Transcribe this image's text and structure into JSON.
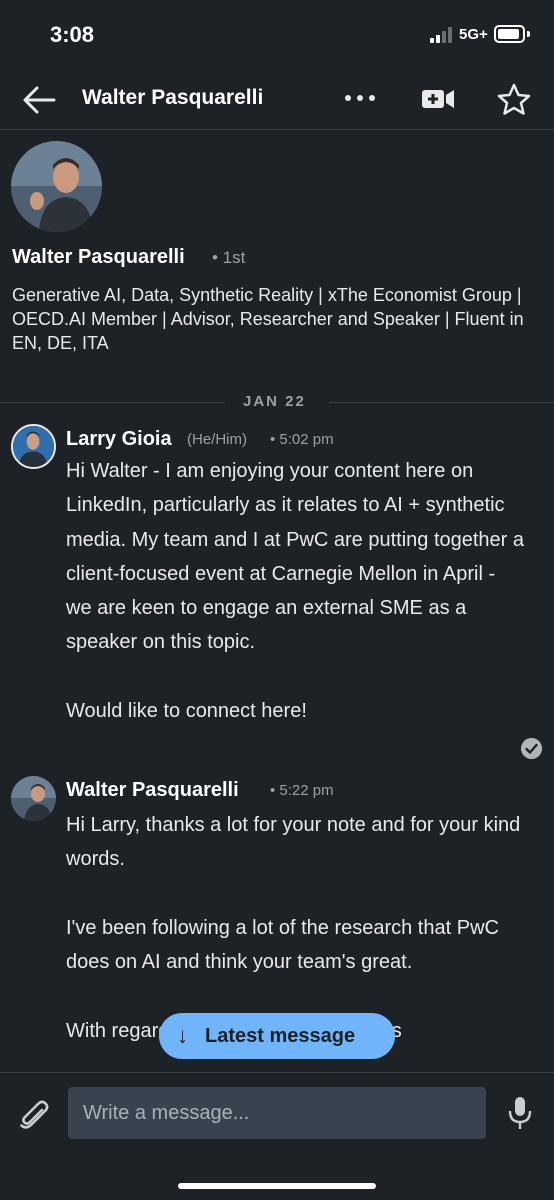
{
  "status_bar": {
    "time": "3:08",
    "network": "5G+"
  },
  "header": {
    "title": "Walter Pasquarelli"
  },
  "profile": {
    "name": "Walter Pasquarelli",
    "degree": "• 1st",
    "headline": "Generative AI, Data, Synthetic Reality | xThe Economist Group | OECD.AI Member | Advisor, Researcher and Speaker | Fluent in EN, DE, ITA"
  },
  "conversation": {
    "date_divider": "JAN 22",
    "messages": [
      {
        "sender": "Larry Gioia",
        "pronouns": "(He/Him)",
        "time": "• 5:02 pm",
        "paragraphs": [
          "Hi Walter - I am enjoying your content here on LinkedIn, particularly as it relates to AI + synthetic media. My team and I at PwC are putting together a client-focused event at Carnegie Mellon in April - we are keen to engage an external SME as a speaker on this topic.",
          "Would like to connect here!"
        ]
      },
      {
        "sender": "Walter Pasquarelli",
        "time": "• 5:22 pm",
        "paragraphs": [
          "Hi Larry, thanks a lot for your note and for your kind words.",
          "I've been following a lot of the research that PwC does on AI and think your team's great.",
          "With regards to the speaking opp, this"
        ]
      }
    ]
  },
  "latest_button": {
    "arrow": "↓",
    "label": "Latest message"
  },
  "composer": {
    "placeholder": "Write a message..."
  },
  "colors": {
    "background": "#1d2226",
    "accent": "#70b5f9",
    "input_bg": "#38434f"
  }
}
